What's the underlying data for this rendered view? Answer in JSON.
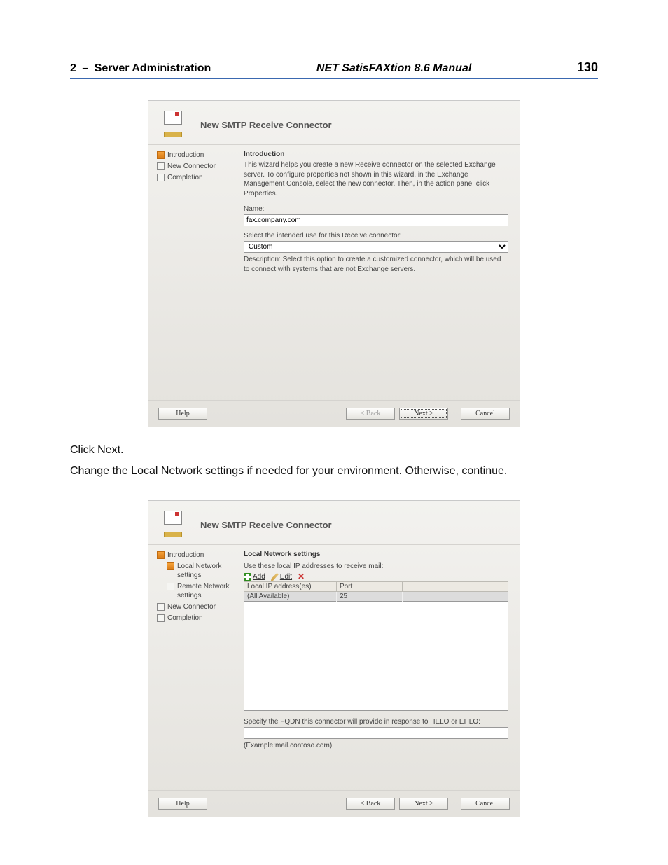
{
  "header": {
    "chapter_num": "2",
    "chapter_title": "Server Administration",
    "manual_title": "NET SatisFAXtion 8.6 Manual",
    "page_num": "130"
  },
  "wiz1": {
    "title": "New SMTP Receive Connector",
    "steps": {
      "intro": "Introduction",
      "newconn": "New Connector",
      "completion": "Completion"
    },
    "heading": "Introduction",
    "intro_text": "This wizard helps you create a new Receive connector on the selected Exchange server. To configure properties not shown in this wizard, in the Exchange Management Console, select the new connector. Then, in the action pane, click Properties.",
    "name_label": "Name:",
    "name_value": "fax.company.com",
    "use_label": "Select the intended use for this Receive connector:",
    "use_value": "Custom",
    "desc": "Description: Select this option to create a customized connector, which will be used to connect with systems that are not Exchange servers.",
    "help": "Help",
    "back": "< Back",
    "next": "Next >",
    "cancel": "Cancel"
  },
  "instr1": "Click Next.",
  "instr2": "Change the Local Network settings if needed for your environment. Otherwise, continue.",
  "wiz2": {
    "title": "New SMTP Receive Connector",
    "steps": {
      "intro": "Introduction",
      "local": "Local Network settings",
      "remote": "Remote Network settings",
      "newconn": "New Connector",
      "completion": "Completion"
    },
    "heading": "Local Network settings",
    "use_text": "Use these local IP addresses to receive mail:",
    "add": "Add",
    "edit": "Edit",
    "del": "✕",
    "col1": "Local IP address(es)",
    "col2": "Port",
    "row1_ip": "(All Available)",
    "row1_port": "25",
    "fqdn_label": "Specify the FQDN this connector will provide in response to HELO or EHLO:",
    "fqdn_example": "(Example:mail.contoso.com)",
    "help": "Help",
    "back": "< Back",
    "next": "Next >",
    "cancel": "Cancel"
  }
}
